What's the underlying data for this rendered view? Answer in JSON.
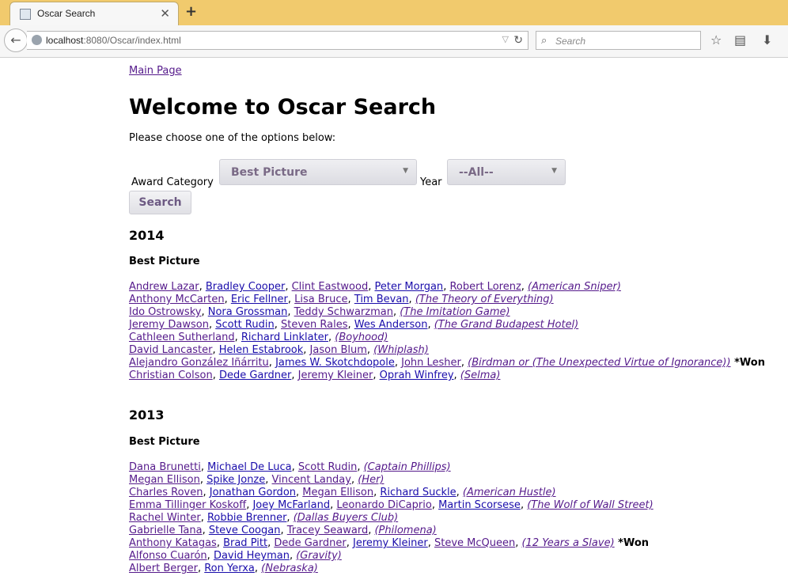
{
  "browser": {
    "tab_title": "Oscar Search",
    "url_host": "localhost",
    "url_rest": ":8080/Oscar/index.html",
    "search_placeholder": "Search"
  },
  "page": {
    "main_link": "Main Page",
    "heading": "Welcome to Oscar Search",
    "intro": "Please choose one of the options below:",
    "award_label": "Award Category",
    "award_value": "Best Picture",
    "year_label": "Year",
    "year_value": "--All--",
    "search_button": "Search",
    "won_text": "*Won"
  },
  "results": [
    {
      "year": "2014",
      "category": "Best Picture",
      "nominations": [
        {
          "people": [
            "Andrew Lazar",
            "Bradley Cooper",
            "Clint Eastwood",
            "Peter Morgan",
            "Robert Lorenz"
          ],
          "film": "(American Sniper)",
          "won": false
        },
        {
          "people": [
            "Anthony McCarten",
            "Eric Fellner",
            "Lisa Bruce",
            "Tim Bevan"
          ],
          "film": "(The Theory of Everything)",
          "won": false
        },
        {
          "people": [
            "Ido Ostrowsky",
            "Nora Grossman",
            "Teddy Schwarzman"
          ],
          "film": "(The Imitation Game)",
          "won": false
        },
        {
          "people": [
            "Jeremy Dawson",
            "Scott Rudin",
            "Steven Rales",
            "Wes Anderson"
          ],
          "film": "(The Grand Budapest Hotel)",
          "won": false
        },
        {
          "people": [
            "Cathleen Sutherland",
            "Richard Linklater"
          ],
          "film": "(Boyhood)",
          "won": false
        },
        {
          "people": [
            "David Lancaster",
            "Helen Estabrook",
            "Jason Blum"
          ],
          "film": "(Whiplash)",
          "won": false
        },
        {
          "people": [
            "Alejandro González Iñárritu",
            "James W. Skotchdopole",
            "John Lesher"
          ],
          "film": "(Birdman or (The Unexpected Virtue of Ignorance))",
          "won": true
        },
        {
          "people": [
            "Christian Colson",
            "Dede Gardner",
            "Jeremy Kleiner",
            "Oprah Winfrey"
          ],
          "film": "(Selma)",
          "won": false
        }
      ]
    },
    {
      "year": "2013",
      "category": "Best Picture",
      "nominations": [
        {
          "people": [
            "Dana Brunetti",
            "Michael De Luca",
            "Scott Rudin"
          ],
          "film": "(Captain Phillips)",
          "won": false
        },
        {
          "people": [
            "Megan Ellison",
            "Spike Jonze",
            "Vincent Landay"
          ],
          "film": "(Her)",
          "won": false
        },
        {
          "people": [
            "Charles Roven",
            "Jonathan Gordon",
            "Megan Ellison",
            "Richard Suckle"
          ],
          "film": "(American Hustle)",
          "won": false
        },
        {
          "people": [
            "Emma Tillinger Koskoff",
            "Joey McFarland",
            "Leonardo DiCaprio",
            "Martin Scorsese"
          ],
          "film": "(The Wolf of Wall Street)",
          "won": false
        },
        {
          "people": [
            "Rachel Winter",
            "Robbie Brenner"
          ],
          "film": "(Dallas Buyers Club)",
          "won": false
        },
        {
          "people": [
            "Gabrielle Tana",
            "Steve Coogan",
            "Tracey Seaward"
          ],
          "film": "(Philomena)",
          "won": false
        },
        {
          "people": [
            "Anthony Katagas",
            "Brad Pitt",
            "Dede Gardner",
            "Jeremy Kleiner",
            "Steve McQueen"
          ],
          "film": "(12 Years a Slave)",
          "won": true
        },
        {
          "people": [
            "Alfonso Cuarón",
            "David Heyman"
          ],
          "film": "(Gravity)",
          "won": false
        },
        {
          "people": [
            "Albert Berger",
            "Ron Yerxa"
          ],
          "film": "(Nebraska)",
          "won": false
        }
      ]
    }
  ]
}
